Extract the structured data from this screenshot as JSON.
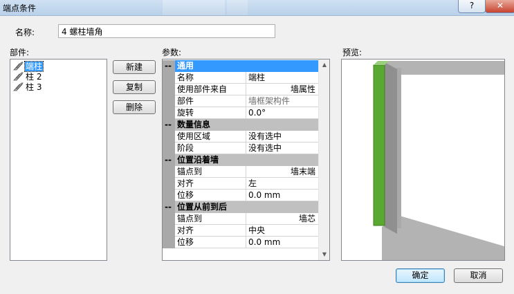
{
  "window": {
    "title": "端点条件",
    "help": "?",
    "close": "✕"
  },
  "name": {
    "label": "名称:",
    "value": "4 螺柱墙角"
  },
  "parts": {
    "label": "部件:",
    "items": [
      {
        "label": "端柱",
        "selected": true
      },
      {
        "label": "柱 2",
        "selected": false
      },
      {
        "label": "柱 3",
        "selected": false
      }
    ]
  },
  "buttons": {
    "new": "新建",
    "copy": "复制",
    "delete": "删除",
    "ok": "确定",
    "cancel": "取消"
  },
  "params": {
    "label": "参数:",
    "rows": [
      {
        "type": "cat",
        "mark": "--",
        "label": "通用",
        "selected": true
      },
      {
        "type": "prop",
        "key": "名称",
        "value": "端柱"
      },
      {
        "type": "prop",
        "key": "使用部件来自",
        "value": "墙属性",
        "align": "right"
      },
      {
        "type": "prop",
        "key": "部件",
        "value": "墙框架构件",
        "disabled": true
      },
      {
        "type": "prop",
        "key": "旋转",
        "value": "0.0°"
      },
      {
        "type": "cat",
        "mark": "--",
        "label": "数量信息"
      },
      {
        "type": "prop",
        "key": "使用区域",
        "value": "没有选中"
      },
      {
        "type": "prop",
        "key": "阶段",
        "value": "没有选中"
      },
      {
        "type": "cat",
        "mark": "--",
        "label": "位置沿着墙"
      },
      {
        "type": "prop",
        "key": "锚点到",
        "value": "墙末端",
        "align": "right"
      },
      {
        "type": "prop",
        "key": "对齐",
        "value": "左"
      },
      {
        "type": "prop",
        "key": "位移",
        "value": "0.0 mm"
      },
      {
        "type": "cat",
        "mark": "--",
        "label": "位置从前到后"
      },
      {
        "type": "prop",
        "key": "锚点到",
        "value": "墙芯",
        "align": "right"
      },
      {
        "type": "prop",
        "key": "对齐",
        "value": "中央"
      },
      {
        "type": "prop",
        "key": "位移",
        "value": "0.0 mm"
      }
    ]
  },
  "preview": {
    "label": "预览:",
    "stud_color": "#5aa832",
    "wall_color": "#b3b3b3"
  },
  "icons": {
    "part": "stud-icon",
    "scroll_up": "arrow-up-icon",
    "scroll_down": "arrow-down-icon"
  }
}
